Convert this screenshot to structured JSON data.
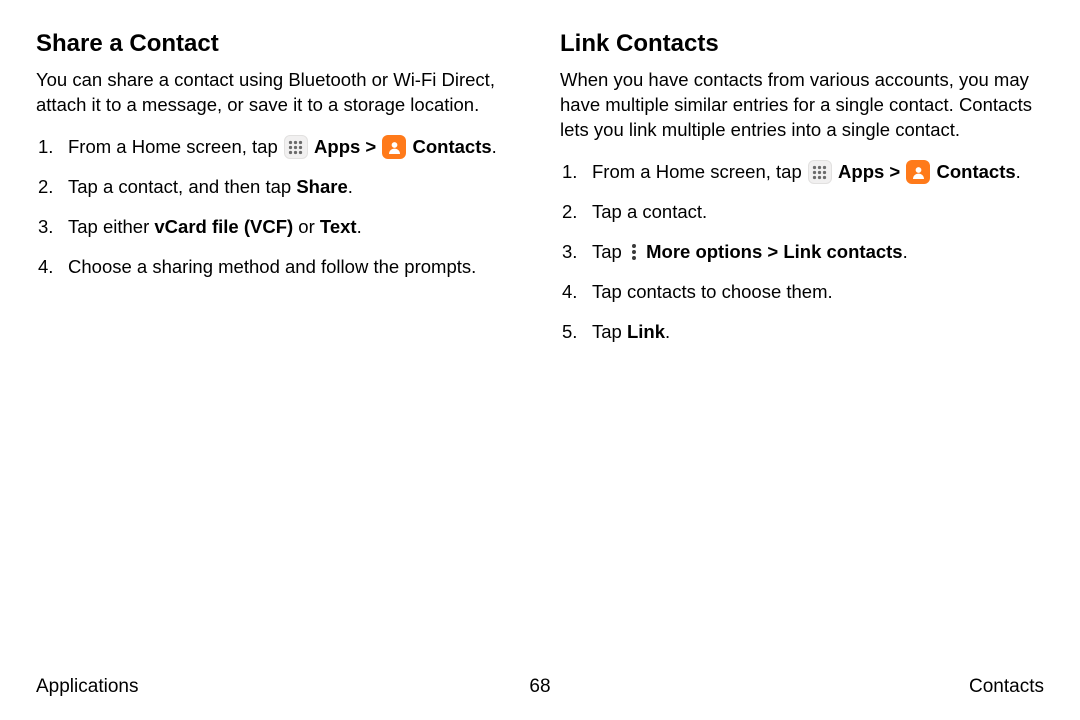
{
  "left": {
    "heading": "Share a Contact",
    "intro": "You can share a contact using Bluetooth or Wi‑Fi Direct, attach it to a message, or save it to a storage location.",
    "step1_a": "From a Home screen, tap ",
    "apps": "Apps",
    "chev": " > ",
    "contacts": "Contacts",
    "step1_end": ".",
    "step2_a": "Tap a contact, and then tap ",
    "step2_b": "Share",
    "step2_end": ".",
    "step3_a": "Tap either ",
    "step3_b": "vCard file (VCF)",
    "step3_c": " or ",
    "step3_d": "Text",
    "step3_end": ".",
    "step4": "Choose a sharing method and follow the prompts."
  },
  "right": {
    "heading": "Link Contacts",
    "intro": "When you have contacts from various accounts, you may have multiple similar entries for a single contact. Contacts lets you link multiple entries into a single contact.",
    "step1_a": "From a Home screen, tap ",
    "apps": "Apps",
    "chev": " > ",
    "contacts": "Contacts",
    "step1_end": ".",
    "step2": "Tap a contact.",
    "step3_a": "Tap ",
    "step3_b": "More options",
    "step3_c": " > ",
    "step3_d": "Link contacts",
    "step3_end": ".",
    "step4": "Tap contacts to choose them.",
    "step5_a": "Tap ",
    "step5_b": "Link",
    "step5_end": "."
  },
  "footer": {
    "left": "Applications",
    "center": "68",
    "right": "Contacts"
  }
}
